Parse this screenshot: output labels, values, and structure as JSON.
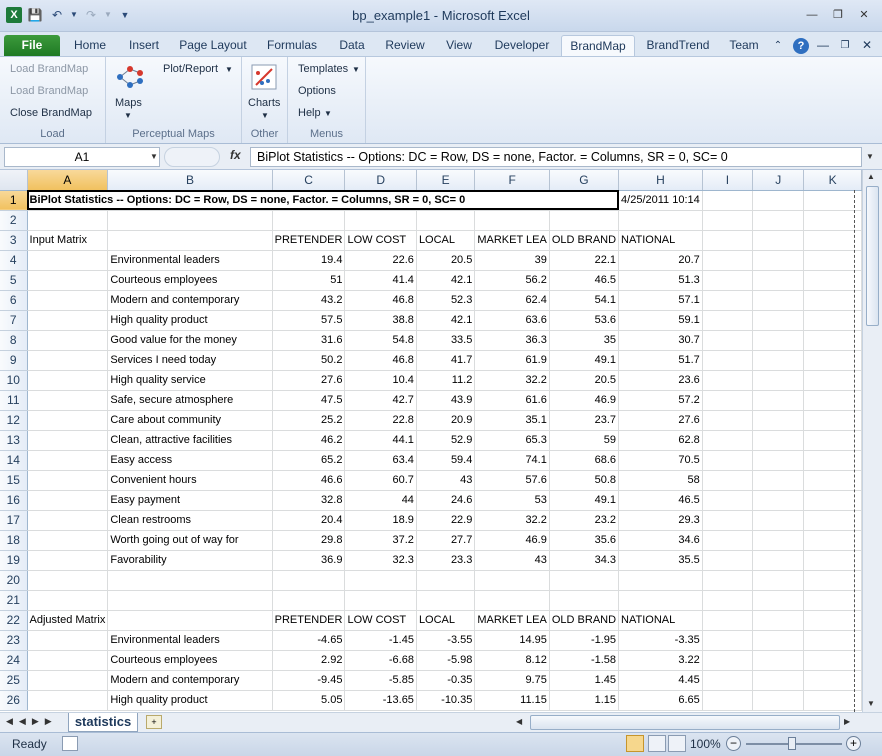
{
  "window": {
    "title": "bp_example1  -  Microsoft Excel"
  },
  "tabs": [
    "File",
    "Home",
    "Insert",
    "Page Layout",
    "Formulas",
    "Data",
    "Review",
    "View",
    "Developer",
    "BrandMap",
    "BrandTrend",
    "Team"
  ],
  "active_tab": "BrandMap",
  "ribbon": {
    "load": {
      "label": "Load",
      "items": [
        "Load BrandMap",
        "Load BrandMap",
        "Close BrandMap"
      ]
    },
    "perceptual": {
      "label": "Perceptual Maps",
      "maps": "Maps",
      "plot_report": "Plot/Report"
    },
    "other": {
      "label": "Other",
      "charts": "Charts"
    },
    "menus": {
      "label": "Menus",
      "templates": "Templates",
      "options": "Options",
      "help": "Help"
    }
  },
  "formula_bar": {
    "name_box": "A1",
    "fx": "fx",
    "content": "BiPlot Statistics -- Options:  DC = Row, DS = none, Factor. = Columns, SR = 0, SC= 0"
  },
  "columns": [
    "A",
    "B",
    "C",
    "D",
    "E",
    "F",
    "G",
    "H",
    "I",
    "J",
    "K"
  ],
  "sheet": {
    "title_text": "BiPlot Statistics -- Options:  DC = Row, DS = none, Factor. = Columns, SR = 0, SC= 0",
    "date": "4/25/2011 10:14",
    "input_label": "Input Matrix",
    "adjusted_label": "Adjusted Matrix",
    "headers": [
      "PRETENDER",
      "LOW COST",
      "LOCAL",
      "MARKET LEA",
      "OLD BRAND",
      "NATIONAL"
    ],
    "input_rows": [
      {
        "label": "Environmental leaders",
        "values": [
          "19.4",
          "22.6",
          "20.5",
          "39",
          "22.1",
          "20.7"
        ]
      },
      {
        "label": "Courteous employees",
        "values": [
          "51",
          "41.4",
          "42.1",
          "56.2",
          "46.5",
          "51.3"
        ]
      },
      {
        "label": "Modern and contemporary",
        "values": [
          "43.2",
          "46.8",
          "52.3",
          "62.4",
          "54.1",
          "57.1"
        ]
      },
      {
        "label": "High quality product",
        "values": [
          "57.5",
          "38.8",
          "42.1",
          "63.6",
          "53.6",
          "59.1"
        ]
      },
      {
        "label": "Good value for the money",
        "values": [
          "31.6",
          "54.8",
          "33.5",
          "36.3",
          "35",
          "30.7"
        ]
      },
      {
        "label": "Services I need today",
        "values": [
          "50.2",
          "46.8",
          "41.7",
          "61.9",
          "49.1",
          "51.7"
        ]
      },
      {
        "label": "High quality service",
        "values": [
          "27.6",
          "10.4",
          "11.2",
          "32.2",
          "20.5",
          "23.6"
        ]
      },
      {
        "label": "Safe, secure atmosphere",
        "values": [
          "47.5",
          "42.7",
          "43.9",
          "61.6",
          "46.9",
          "57.2"
        ]
      },
      {
        "label": "Care about community",
        "values": [
          "25.2",
          "22.8",
          "20.9",
          "35.1",
          "23.7",
          "27.6"
        ]
      },
      {
        "label": "Clean, attractive facilities",
        "values": [
          "46.2",
          "44.1",
          "52.9",
          "65.3",
          "59",
          "62.8"
        ]
      },
      {
        "label": "Easy access",
        "values": [
          "65.2",
          "63.4",
          "59.4",
          "74.1",
          "68.6",
          "70.5"
        ]
      },
      {
        "label": "Convenient hours",
        "values": [
          "46.6",
          "60.7",
          "43",
          "57.6",
          "50.8",
          "58"
        ]
      },
      {
        "label": "Easy payment",
        "values": [
          "32.8",
          "44",
          "24.6",
          "53",
          "49.1",
          "46.5"
        ]
      },
      {
        "label": "Clean restrooms",
        "values": [
          "20.4",
          "18.9",
          "22.9",
          "32.2",
          "23.2",
          "29.3"
        ]
      },
      {
        "label": "Worth going out of way for",
        "values": [
          "29.8",
          "37.2",
          "27.7",
          "46.9",
          "35.6",
          "34.6"
        ]
      },
      {
        "label": "Favorability",
        "values": [
          "36.9",
          "32.3",
          "23.3",
          "43",
          "34.3",
          "35.5"
        ]
      }
    ],
    "adjusted_rows": [
      {
        "label": "Environmental leaders",
        "values": [
          "-4.65",
          "-1.45",
          "-3.55",
          "14.95",
          "-1.95",
          "-3.35"
        ]
      },
      {
        "label": "Courteous employees",
        "values": [
          "2.92",
          "-6.68",
          "-5.98",
          "8.12",
          "-1.58",
          "3.22"
        ]
      },
      {
        "label": "Modern and contemporary",
        "values": [
          "-9.45",
          "-5.85",
          "-0.35",
          "9.75",
          "1.45",
          "4.45"
        ]
      },
      {
        "label": "High quality product",
        "values": [
          "5.05",
          "-13.65",
          "-10.35",
          "11.15",
          "1.15",
          "6.65"
        ]
      }
    ]
  },
  "sheet_tab": "statistics",
  "status": {
    "ready": "Ready",
    "zoom": "100%"
  }
}
